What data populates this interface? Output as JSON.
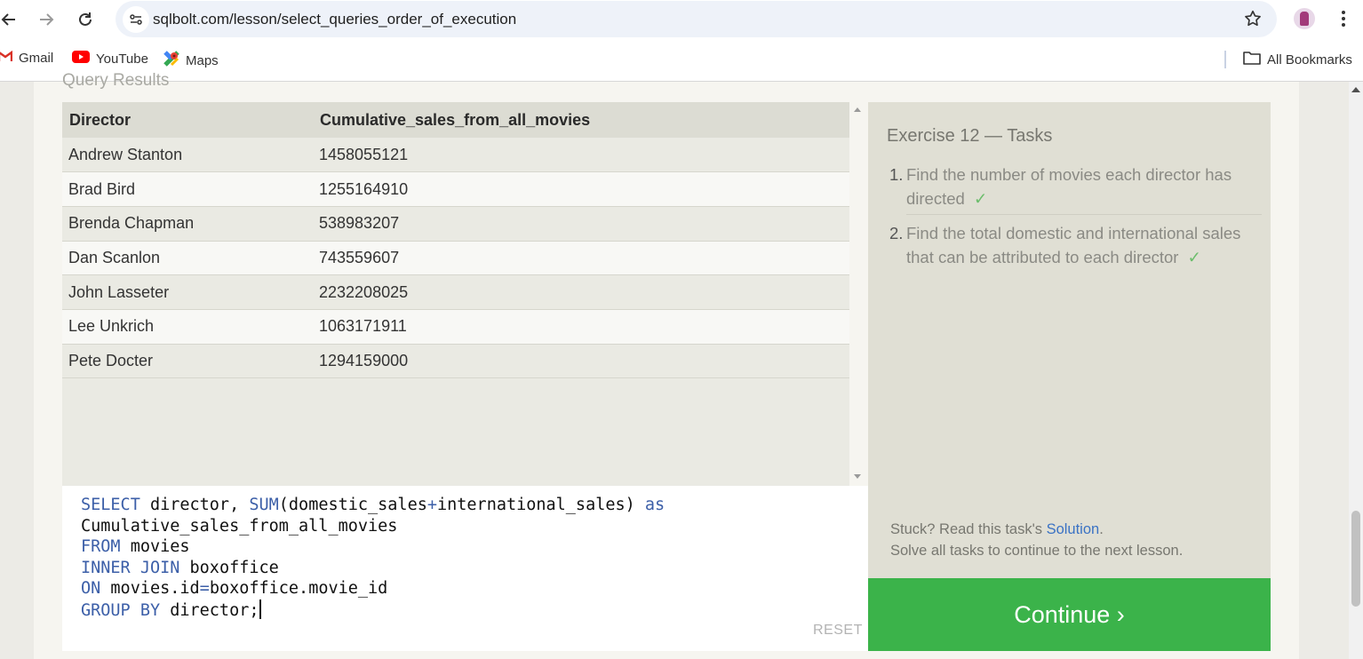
{
  "browser": {
    "url": "sqlbolt.com/lesson/select_queries_order_of_execution",
    "bookmarks": [
      {
        "label": "Gmail"
      },
      {
        "label": "YouTube"
      },
      {
        "label": "Maps"
      }
    ],
    "all_bookmarks_label": "All Bookmarks",
    "colors": {
      "gmail_red": "#d93025",
      "youtube_red": "#ff0000"
    }
  },
  "page": {
    "results_label": "Query Results",
    "results": {
      "columns": [
        "Director",
        "Cumulative_sales_from_all_movies"
      ],
      "rows": [
        [
          "Andrew Stanton",
          "1458055121"
        ],
        [
          "Brad Bird",
          "1255164910"
        ],
        [
          "Brenda Chapman",
          "538983207"
        ],
        [
          "Dan Scanlon",
          "743559607"
        ],
        [
          "John Lasseter",
          "2232208025"
        ],
        [
          "Lee Unkrich",
          "1063171911"
        ],
        [
          "Pete Docter",
          "1294159000"
        ]
      ]
    },
    "editor": {
      "lines": [
        [
          {
            "t": "SELECT",
            "k": true
          },
          {
            "t": " director, ",
            "k": false
          },
          {
            "t": "SUM",
            "k": true
          },
          {
            "t": "(domestic_sales",
            "k": false
          },
          {
            "t": "+",
            "k": true
          },
          {
            "t": "international_sales) ",
            "k": false
          },
          {
            "t": "as",
            "k": true
          }
        ],
        [
          {
            "t": "Cumulative_sales_from_all_movies",
            "k": false
          }
        ],
        [
          {
            "t": "FROM",
            "k": true
          },
          {
            "t": " movies",
            "k": false
          }
        ],
        [
          {
            "t": "INNER JOIN",
            "k": true
          },
          {
            "t": " boxoffice",
            "k": false
          }
        ],
        [
          {
            "t": "ON",
            "k": true
          },
          {
            "t": " movies.id",
            "k": false
          },
          {
            "t": "=",
            "k": true
          },
          {
            "t": "boxoffice.movie_id",
            "k": false
          }
        ],
        [
          {
            "t": "GROUP BY",
            "k": true
          },
          {
            "t": " director;",
            "k": false
          }
        ]
      ],
      "reset_label": "RESET"
    },
    "tasks": {
      "title": "Exercise 12 — Tasks",
      "items": [
        {
          "num": "1.",
          "text": "Find the number of movies each director has directed",
          "check": "✓"
        },
        {
          "num": "2.",
          "text": "Find the total domestic and international sales that can be attributed to each director",
          "check": "✓"
        }
      ],
      "stuck_prefix": "Stuck? Read this task's ",
      "solution_link": "Solution",
      "stuck_suffix": ".",
      "solve_all": "Solve all tasks to continue to the next lesson."
    },
    "continue_label": "Continue ›",
    "colors": {
      "continue_green": "#3bb34a",
      "keyword_blue": "#3c5fa8",
      "check_green": "#6bbd6b",
      "link_blue": "#3a72c4"
    }
  }
}
